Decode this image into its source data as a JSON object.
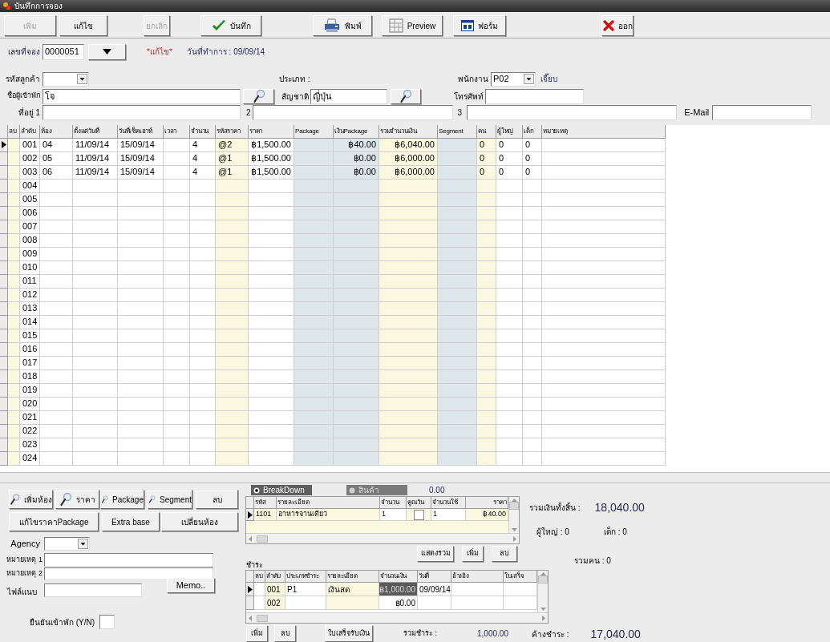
{
  "window": {
    "title": "บันทึกการจอง"
  },
  "toolbar": [
    {
      "label": "เพิ่ม",
      "disabled": true,
      "kind": "plain"
    },
    {
      "label": "แก้ไข",
      "disabled": false,
      "kind": "plain"
    },
    {
      "label": "ยกเลิก",
      "disabled": true,
      "kind": "plain"
    },
    {
      "label": "บันทึก",
      "disabled": false,
      "kind": "save"
    },
    {
      "label": "พิมพ์",
      "disabled": false,
      "kind": "print"
    },
    {
      "label": "Preview",
      "disabled": false,
      "kind": "preview"
    },
    {
      "label": "ฟอร์ม",
      "disabled": false,
      "kind": "form"
    },
    {
      "label": "ออก",
      "disabled": false,
      "kind": "exit"
    }
  ],
  "booking": {
    "number_label": "เลขที่จอง",
    "number": "0000051",
    "mode": "*แก้ไข*",
    "date": "วันที่ทำการ : 09/09/14"
  },
  "customer": {
    "code_label": "รหัสลูกค้า",
    "type_label": "ประเภท :",
    "staff_label": "พนักงาน",
    "staff_code": "P02",
    "staff_name": "เจี๊ยบ",
    "guest_label": "ชื่อผู้เข้าพัก",
    "guest_name": "โจ",
    "nationality_label": "สัญชาติ",
    "nationality": "ญี่ปุ่น",
    "phone_label": "โทรศัพท์",
    "address_labels": [
      "ที่อยู่ 1",
      "2",
      "3"
    ],
    "email_label": "E-Mail"
  },
  "rooms": {
    "columns": [
      {
        "label": "ลบ",
        "kind": "editable"
      },
      {
        "label": "ลำดับ",
        "kind": "plain"
      },
      {
        "label": "ห้อง",
        "kind": "plain"
      },
      {
        "label": "ตั้งแต่วันที่",
        "kind": "plain"
      },
      {
        "label": "วันที่เช็คเอาท์",
        "kind": "plain"
      },
      {
        "label": "เวลา",
        "kind": "plain"
      },
      {
        "label": "จำนวน",
        "kind": "plain"
      },
      {
        "label": "รหัสราคา",
        "kind": "editable"
      },
      {
        "label": "ราคา",
        "kind": "plain"
      },
      {
        "label": "Package",
        "kind": "lookup"
      },
      {
        "label": "เงินPackage",
        "kind": "lookup"
      },
      {
        "label": "รวมจำนวนเงิน",
        "kind": "editable"
      },
      {
        "label": "Segment",
        "kind": "lookup"
      },
      {
        "label": "คน",
        "kind": "editable"
      },
      {
        "label": "ผู้ใหญ่",
        "kind": "plain"
      },
      {
        "label": "เด็ก",
        "kind": "plain"
      },
      {
        "label": "หมายเหตุ",
        "kind": "plain"
      }
    ],
    "rows": [
      {
        "selected": true,
        "no": "001",
        "room": "04",
        "from": "11/09/14",
        "to": "15/09/14",
        "quantity": "4",
        "rate_code": "@2",
        "price": "฿1,500.00",
        "package_amount": "฿40.00",
        "total": "฿6,040.00",
        "people": "0",
        "adults": "0",
        "children": "0"
      },
      {
        "selected": false,
        "no": "002",
        "room": "05",
        "from": "11/09/14",
        "to": "15/09/14",
        "quantity": "4",
        "rate_code": "@1",
        "price": "฿1,500.00",
        "package_amount": "฿0.00",
        "total": "฿6,000.00",
        "people": "0",
        "adults": "0",
        "children": "0"
      },
      {
        "selected": false,
        "no": "003",
        "room": "06",
        "from": "11/09/14",
        "to": "15/09/14",
        "quantity": "4",
        "rate_code": "@1",
        "price": "฿1,500.00",
        "package_amount": "฿0.00",
        "total": "฿6,000.00",
        "people": "0",
        "adults": "0",
        "children": "0"
      },
      {
        "selected": false,
        "no": "004"
      },
      {
        "selected": false,
        "no": "005"
      },
      {
        "selected": false,
        "no": "006"
      },
      {
        "selected": false,
        "no": "007"
      },
      {
        "selected": false,
        "no": "008"
      },
      {
        "selected": false,
        "no": "009"
      },
      {
        "selected": false,
        "no": "010"
      },
      {
        "selected": false,
        "no": "011"
      },
      {
        "selected": false,
        "no": "012"
      },
      {
        "selected": false,
        "no": "013"
      },
      {
        "selected": false,
        "no": "014"
      },
      {
        "selected": false,
        "no": "015"
      },
      {
        "selected": false,
        "no": "016"
      },
      {
        "selected": false,
        "no": "017"
      },
      {
        "selected": false,
        "no": "018"
      },
      {
        "selected": false,
        "no": "019"
      },
      {
        "selected": false,
        "no": "020"
      },
      {
        "selected": false,
        "no": "021"
      },
      {
        "selected": false,
        "no": "022"
      },
      {
        "selected": false,
        "no": "023"
      },
      {
        "selected": false,
        "no": "024"
      }
    ]
  },
  "room_buttons": [
    {
      "label": "เพิ่มห้อง",
      "kind": "lookup"
    },
    {
      "label": "ราคา",
      "kind": "lookup"
    },
    {
      "label": "Package",
      "kind": "lookup"
    },
    {
      "label": "Segment",
      "kind": "lookup"
    },
    {
      "label": "ลบ",
      "kind": "plain"
    },
    {
      "label": "แก้ไขราคาPackage",
      "kind": "plain"
    },
    {
      "label": "Extra base",
      "kind": "plain"
    },
    {
      "label": "เปลี่ยนห้อง",
      "kind": "plain"
    }
  ],
  "extra": {
    "agency_label": "Agency",
    "note1_label": "หมายเหตุ 1",
    "note2_label": "หมายเหตุ 2",
    "attach_label": "ไฟล์แนบ",
    "memo_button": "Memo..",
    "confirm_label": "ยืนยันเข้าพัก (Y/N)"
  },
  "items": {
    "tabs": [
      {
        "label": "BreakDown",
        "selected": true
      },
      {
        "label": "สินค้า",
        "selected": false
      }
    ],
    "amount": "0.00",
    "columns": [
      "รหัส",
      "รายละเอียด",
      "จำนวน",
      "คูณวัน",
      "จำนวนใช้",
      "ราคา"
    ],
    "rows": [
      {
        "selected": true,
        "code": "1101",
        "detail": "อาหารจานเดียว",
        "quantity": "1",
        "per_day": false,
        "used": "1",
        "price": "฿40.00"
      }
    ],
    "buttons": [
      "แสดงรวม",
      "เพิ่ม",
      "ลบ"
    ]
  },
  "payment": {
    "label": "ชำระ",
    "columns": [
      "ลบ",
      "ลำดับ",
      "ประเภทชำระ",
      "รายละเอียด",
      "จำนวนเงิน",
      "วันที่",
      "อ้างอิง",
      "ใบเสร็จ"
    ],
    "rows": [
      {
        "selected": true,
        "no": "001",
        "type": "P1",
        "detail": "เงินสด",
        "amount": "฿1,000.00",
        "amount_focused": true,
        "date": "09/09/14"
      },
      {
        "selected": false,
        "no": "002",
        "amount": "฿0.00",
        "amount_focused": false
      }
    ],
    "buttons": [
      "เพิ่ม",
      "ลบ",
      "ใบเสร็จรับเงิน"
    ],
    "total_label": "รวมชำระ :",
    "total": "1,000.00"
  },
  "summary": {
    "grand_total_label": "รวมเงินทั้งสิ้น :",
    "grand_total": "18,040.00",
    "adults": "ผู้ใหญ่ : 0",
    "children": "เด็ก : 0",
    "people": "รวมคน :  0",
    "balance_label": "ค้างชำระ :",
    "balance": "17,040.00"
  }
}
